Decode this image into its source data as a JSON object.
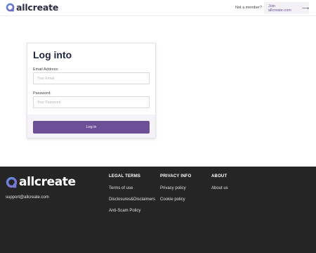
{
  "header": {
    "logo_text": "allcreate",
    "not_member": "Not a member?",
    "join_link": "Join allcreate.com",
    "join_arrow": "⟶"
  },
  "login": {
    "title": "Log into",
    "email_label": "Email Address:",
    "email_placeholder": "Your Email",
    "password_label": "Password:",
    "password_placeholder": "Your Password",
    "button_label": "Log in"
  },
  "footer": {
    "logo_text": "allcreate",
    "support_email": "support@allcreate.com",
    "columns": [
      {
        "title": "LEGAL TERMS",
        "links": [
          "Terms of use",
          "Disclosures&Disclaimers",
          "Anti-Scam Policy"
        ]
      },
      {
        "title": "PRIVACY INFO",
        "links": [
          "Privacy policy",
          "Cookie policy"
        ]
      },
      {
        "title": "ABOUT",
        "links": [
          "About us"
        ]
      }
    ]
  },
  "colors": {
    "brand_purple": "#6c4f96",
    "brand_blue": "#4a7fd6",
    "footer_bg": "#252525"
  }
}
